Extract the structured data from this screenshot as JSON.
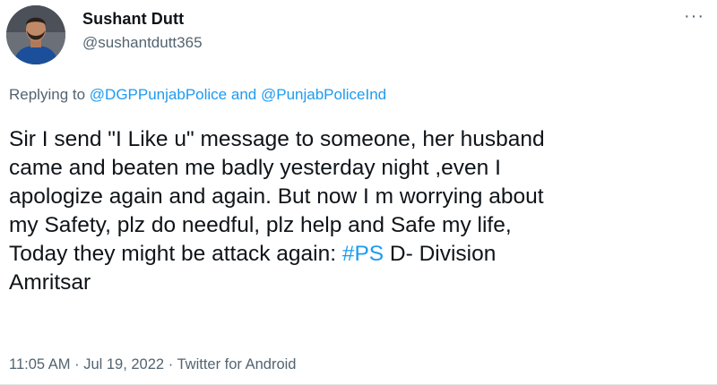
{
  "tweet": {
    "author_name": "Sushant Dutt",
    "author_handle": "@sushantdutt365",
    "more_icon": "···",
    "replying_prefix": "Replying to",
    "reply_mention_1": "@DGPPunjabPolice",
    "reply_connector": "and",
    "reply_mention_2": "@PunjabPoliceInd",
    "body_lines": [
      "Sir I send \"I Like u\" message to someone, her husband",
      "came and beaten me badly yesterday night ,even I",
      "apologize again and again. But now I m worrying about",
      "my Safety, plz do needful, plz help and Safe my life,",
      "Today they might be attack again: "
    ],
    "hashtag": "#PS",
    "body_after_hashtag": " D- Division",
    "body_last_line": "Amritsar",
    "time": "11:05 AM",
    "date": "Jul 19, 2022",
    "source": "Twitter for Android",
    "separator": "·"
  },
  "colors": {
    "link": "#1d9bf0",
    "secondary_text": "#536471",
    "primary_text": "#0f1419"
  }
}
